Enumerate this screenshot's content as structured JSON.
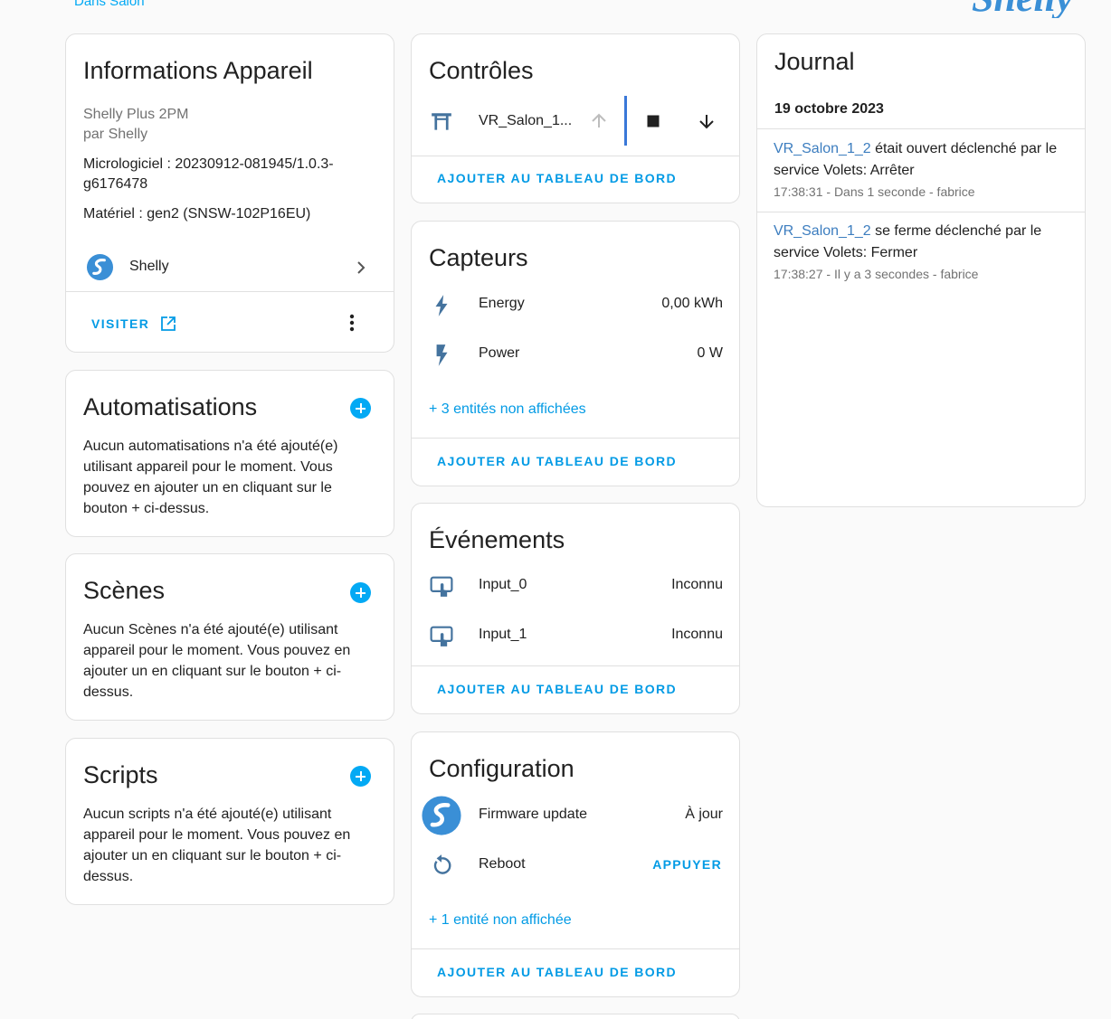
{
  "header": {
    "area_link": "Dans Salon",
    "brand_logo": "Shelly"
  },
  "device_info": {
    "title": "Informations Appareil",
    "model": "Shelly Plus 2PM",
    "manufacturer": "par Shelly",
    "firmware": "Micrologiciel : 20230912-081945/1.0.3-g6176478",
    "hardware": "Matériel : gen2 (SNSW-102P16EU)",
    "integration_name": "Shelly",
    "visit_label": "VISITER",
    "icons": [
      "shelly-logo-icon",
      "chevron-right-icon",
      "open-in-new-icon",
      "more-vertical-icon"
    ]
  },
  "automations": {
    "title": "Automatisations",
    "empty_text": "Aucun automatisations n'a été ajouté(e) utilisant appareil pour le moment. Vous pouvez en ajouter un en cliquant sur le bouton + ci-dessus."
  },
  "scenes": {
    "title": "Scènes",
    "empty_text": "Aucun Scènes n'a été ajouté(e) utilisant appareil pour le moment. Vous pouvez en ajouter un en cliquant sur le bouton + ci-dessus."
  },
  "scripts": {
    "title": "Scripts",
    "empty_text": "Aucun scripts n'a été ajouté(e) utilisant appareil pour le moment. Vous pouvez en ajouter un en cliquant sur le bouton + ci-dessus."
  },
  "controls": {
    "title": "Contrôles",
    "entity_name": "VR_Salon_1...",
    "add_to_dashboard": "AJOUTER AU TABLEAU DE BORD",
    "icons": [
      "window-shutter-icon",
      "arrow-up-icon",
      "stop-icon",
      "arrow-down-icon"
    ]
  },
  "sensors": {
    "title": "Capteurs",
    "rows": [
      {
        "label": "Energy",
        "value": "0,00 kWh",
        "icon": "lightning-bolt-icon"
      },
      {
        "label": "Power",
        "value": "0 W",
        "icon": "flash-icon"
      }
    ],
    "hidden_entities": "+ 3 entités non affichées",
    "add_to_dashboard": "AJOUTER AU TABLEAU DE BORD"
  },
  "events": {
    "title": "Événements",
    "rows": [
      {
        "label": "Input_0",
        "value": "Inconnu",
        "icon": "gesture-tap-button-icon"
      },
      {
        "label": "Input_1",
        "value": "Inconnu",
        "icon": "gesture-tap-button-icon"
      }
    ],
    "add_to_dashboard": "AJOUTER AU TABLEAU DE BORD"
  },
  "configuration": {
    "title": "Configuration",
    "rows": [
      {
        "label": "Firmware update",
        "value": "À jour",
        "icon": "shelly-logo-icon"
      },
      {
        "label": "Reboot",
        "value": "APPUYER",
        "icon": "restart-icon"
      }
    ],
    "hidden_entities": "+ 1 entité non affichée",
    "add_to_dashboard": "AJOUTER AU TABLEAU DE BORD"
  },
  "logbook": {
    "title": "Journal",
    "date": "19 octobre 2023",
    "entries": [
      {
        "entity": "VR_Salon_1_2",
        "message": " était ouvert déclenché par le service Volets: Arrêter",
        "time": "17:38:31 - Dans 1 seconde - fabrice"
      },
      {
        "entity": "VR_Salon_1_2",
        "message": " se ferme déclenché par le service Volets: Fermer",
        "time": "17:38:27 - Il y a 3 secondes - fabrice"
      }
    ]
  },
  "colors": {
    "accent": "#03a9f4",
    "link": "#039be5",
    "entity_link": "#3c7dbf",
    "icon": "#44739e",
    "border": "#e0e0e0"
  }
}
